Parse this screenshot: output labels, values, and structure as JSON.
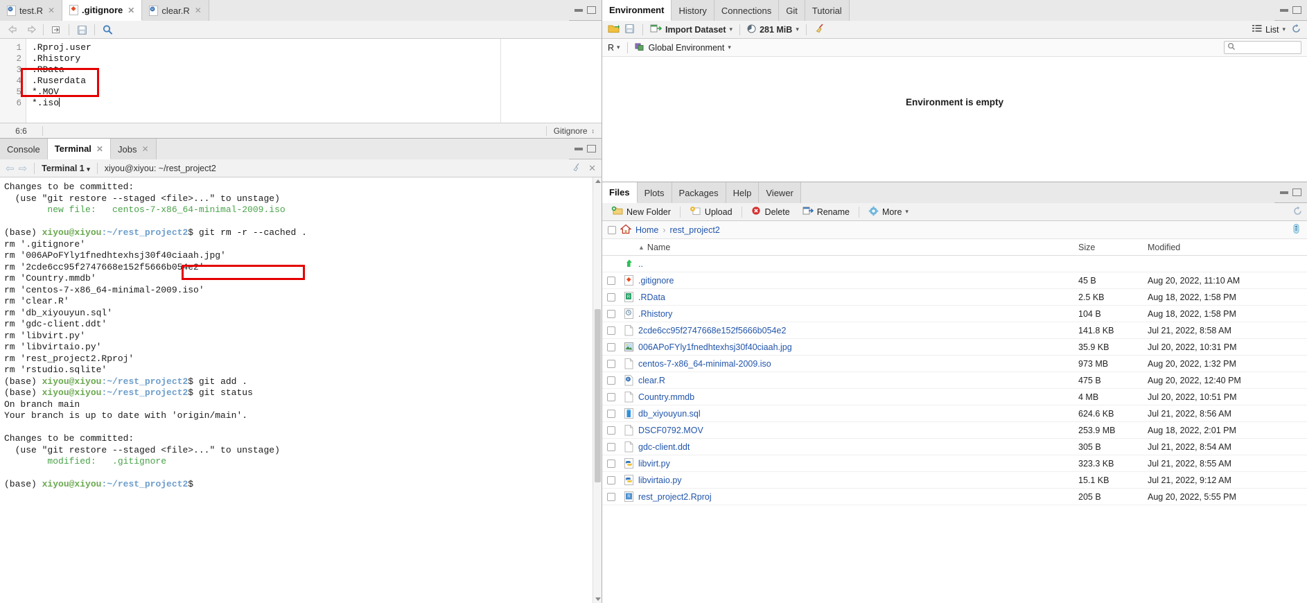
{
  "source": {
    "tabs": [
      {
        "label": "test.R",
        "icon": "r-script-icon",
        "active": false
      },
      {
        "label": ".gitignore",
        "icon": "gitignore-icon",
        "active": true
      },
      {
        "label": "clear.R",
        "icon": "r-script-icon",
        "active": false
      }
    ],
    "toolbar": [
      "back-arrow-icon",
      "forward-arrow-icon",
      "popout-icon",
      "save-icon",
      "find-icon"
    ],
    "lines": [
      {
        "n": "1",
        "text": ".Rproj.user"
      },
      {
        "n": "2",
        "text": ".Rhistory"
      },
      {
        "n": "3",
        "text": ".RData"
      },
      {
        "n": "4",
        "text": ".Ruserdata"
      },
      {
        "n": "5",
        "text": "*.MOV"
      },
      {
        "n": "6",
        "text": "*.iso"
      }
    ],
    "status": {
      "position": "6:6",
      "mode": "Gitignore"
    },
    "highlight_color": "#e40000"
  },
  "console": {
    "tabs": [
      {
        "label": "Console",
        "closable": false,
        "active": false
      },
      {
        "label": "Terminal",
        "closable": true,
        "active": true
      },
      {
        "label": "Jobs",
        "closable": true,
        "active": false
      }
    ],
    "terminal_selector": "Terminal 1",
    "terminal_host": "xiyou@xiyou: ~/rest_project2",
    "prompt_user": "xiyou@xiyou",
    "prompt_path": ":~/rest_project2",
    "prompt_prefix": "(base) ",
    "highlight_color": "#e40000",
    "highlighted_command": "git rm -r --cached .",
    "lines": [
      {
        "t": "plain",
        "text": "Changes to be committed:"
      },
      {
        "t": "plain",
        "text": "  (use \"git restore --staged <file>...\" to unstage)"
      },
      {
        "t": "green",
        "text": "        new file:   centos-7-x86_64-minimal-2009.iso"
      },
      {
        "t": "plain",
        "text": ""
      },
      {
        "t": "prompt",
        "cmd": " git rm -r --cached .",
        "boxed": true
      },
      {
        "t": "plain",
        "text": "rm '.gitignore'"
      },
      {
        "t": "plain",
        "text": "rm '006APoFYly1fnedhtexhsj30f40ciaah.jpg'"
      },
      {
        "t": "plain",
        "text": "rm '2cde6cc95f2747668e152f5666b054e2'"
      },
      {
        "t": "plain",
        "text": "rm 'Country.mmdb'"
      },
      {
        "t": "plain",
        "text": "rm 'centos-7-x86_64-minimal-2009.iso'"
      },
      {
        "t": "plain",
        "text": "rm 'clear.R'"
      },
      {
        "t": "plain",
        "text": "rm 'db_xiyouyun.sql'"
      },
      {
        "t": "plain",
        "text": "rm 'gdc-client.ddt'"
      },
      {
        "t": "plain",
        "text": "rm 'libvirt.py'"
      },
      {
        "t": "plain",
        "text": "rm 'libvirtaio.py'"
      },
      {
        "t": "plain",
        "text": "rm 'rest_project2.Rproj'"
      },
      {
        "t": "plain",
        "text": "rm 'rstudio.sqlite'"
      },
      {
        "t": "prompt",
        "cmd": " git add .",
        "boxed": false
      },
      {
        "t": "prompt",
        "cmd": " git status",
        "boxed": false
      },
      {
        "t": "plain",
        "text": "On branch main"
      },
      {
        "t": "plain",
        "text": "Your branch is up to date with 'origin/main'."
      },
      {
        "t": "plain",
        "text": ""
      },
      {
        "t": "plain",
        "text": "Changes to be committed:"
      },
      {
        "t": "plain",
        "text": "  (use \"git restore --staged <file>...\" to unstage)"
      },
      {
        "t": "green",
        "text": "        modified:   .gitignore"
      },
      {
        "t": "plain",
        "text": ""
      },
      {
        "t": "prompt",
        "cmd": "",
        "boxed": false
      }
    ]
  },
  "environment": {
    "tabs": [
      {
        "label": "Environment",
        "active": true
      },
      {
        "label": "History",
        "active": false
      },
      {
        "label": "Connections",
        "active": false
      },
      {
        "label": "Git",
        "active": false
      },
      {
        "label": "Tutorial",
        "active": false
      }
    ],
    "toolbar": {
      "load_icon": "open-folder-icon",
      "save_icon": "save-icon",
      "import_label": "Import Dataset",
      "memory_label": "281 MiB",
      "broom_icon": "broom-icon",
      "list_label": "List",
      "refresh_icon": "refresh-icon"
    },
    "scope": {
      "language": "R",
      "environment": "Global Environment"
    },
    "search_placeholder": "",
    "empty_message": "Environment is empty"
  },
  "files": {
    "tabs": [
      {
        "label": "Files",
        "active": true
      },
      {
        "label": "Plots",
        "active": false
      },
      {
        "label": "Packages",
        "active": false
      },
      {
        "label": "Help",
        "active": false
      },
      {
        "label": "Viewer",
        "active": false
      }
    ],
    "toolbar": [
      {
        "label": "New Folder",
        "icon": "new-folder-icon"
      },
      {
        "label": "Upload",
        "icon": "upload-icon"
      },
      {
        "label": "Delete",
        "icon": "delete-icon"
      },
      {
        "label": "Rename",
        "icon": "rename-icon"
      },
      {
        "label": "More",
        "icon": "gear-icon"
      }
    ],
    "breadcrumb": {
      "home": "Home",
      "separator": "›",
      "current": "rest_project2"
    },
    "columns": {
      "name": "Name",
      "size": "Size",
      "modified": "Modified"
    },
    "sort_indicator": "▲",
    "parent_row": "..",
    "rows": [
      {
        "name": ".gitignore",
        "size": "45 B",
        "modified": "Aug 20, 2022, 11:10 AM",
        "icon": "gitignore-icon"
      },
      {
        "name": ".RData",
        "size": "2.5 KB",
        "modified": "Aug 18, 2022, 1:58 PM",
        "icon": "rdata-icon"
      },
      {
        "name": ".Rhistory",
        "size": "104 B",
        "modified": "Aug 18, 2022, 1:58 PM",
        "icon": "rhistory-icon"
      },
      {
        "name": "2cde6cc95f2747668e152f5666b054e2",
        "size": "141.8 KB",
        "modified": "Jul 21, 2022, 8:58 AM",
        "icon": "blank-file-icon"
      },
      {
        "name": "006APoFYly1fnedhtexhsj30f40ciaah.jpg",
        "size": "35.9 KB",
        "modified": "Jul 20, 2022, 10:31 PM",
        "icon": "image-file-icon"
      },
      {
        "name": "centos-7-x86_64-minimal-2009.iso",
        "size": "973 MB",
        "modified": "Aug 20, 2022, 1:32 PM",
        "icon": "blank-file-icon"
      },
      {
        "name": "clear.R",
        "size": "475 B",
        "modified": "Aug 20, 2022, 12:40 PM",
        "icon": "r-script-icon"
      },
      {
        "name": "Country.mmdb",
        "size": "4 MB",
        "modified": "Jul 20, 2022, 10:51 PM",
        "icon": "blank-file-icon"
      },
      {
        "name": "db_xiyouyun.sql",
        "size": "624.6 KB",
        "modified": "Jul 21, 2022, 8:56 AM",
        "icon": "sql-file-icon"
      },
      {
        "name": "DSCF0792.MOV",
        "size": "253.9 MB",
        "modified": "Aug 18, 2022, 2:01 PM",
        "icon": "blank-file-icon"
      },
      {
        "name": "gdc-client.ddt",
        "size": "305 B",
        "modified": "Jul 21, 2022, 8:54 AM",
        "icon": "blank-file-icon"
      },
      {
        "name": "libvirt.py",
        "size": "323.3 KB",
        "modified": "Jul 21, 2022, 8:55 AM",
        "icon": "python-file-icon"
      },
      {
        "name": "libvirtaio.py",
        "size": "15.1 KB",
        "modified": "Jul 21, 2022, 9:12 AM",
        "icon": "python-file-icon"
      },
      {
        "name": "rest_project2.Rproj",
        "size": "205 B",
        "modified": "Aug 20, 2022, 5:55 PM",
        "icon": "rproj-file-icon"
      }
    ]
  }
}
